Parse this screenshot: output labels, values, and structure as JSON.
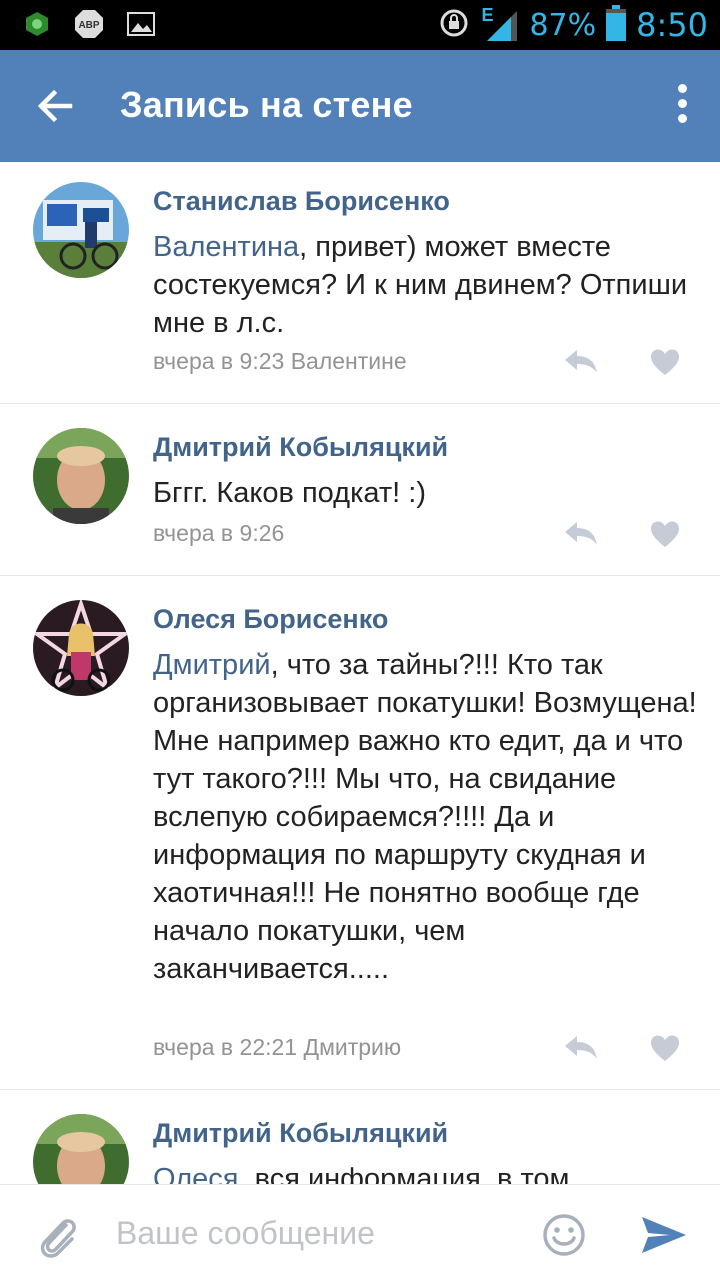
{
  "status_bar": {
    "icons": [
      "app-icon",
      "abp-icon",
      "image-icon"
    ],
    "abp_label": "ABP",
    "network": "E",
    "battery": "87%",
    "time": "8:50"
  },
  "toolbar": {
    "title": "Запись на стене",
    "back_icon": "arrow-left-icon",
    "menu_icon": "more-vert-icon"
  },
  "comments": [
    {
      "author": "Станислав Борисенко",
      "mention": "Валентина",
      "text": ", привет)  может вместе состекуемся?  И к ним двинем? Отпиши мне в л.с.",
      "meta": "вчера в 9:23 Валентине"
    },
    {
      "author": "Дмитрий Кобыляцкий",
      "mention": "",
      "text": "Бггг. Каков подкат! :)",
      "meta": "вчера в 9:26"
    },
    {
      "author": "Олеся Борисенко",
      "mention": "Дмитрий",
      "text": ", что за тайны?!!! Кто так организовывает покатушки! Возмущена! Мне например важно кто едит, да и что тут такого?!!! Мы что, на свидание вслепую собираемся?!!!! Да и информация по маршруту скудная и хаотичная!!! Не понятно  вообще где начало покатушки, чем заканчивается.....",
      "meta": "вчера в 22:21 Дмитрию"
    },
    {
      "author": "Дмитрий Кобыляцкий",
      "mention": "Олеся",
      "text": ", вся информация, в том",
      "meta": ""
    }
  ],
  "composer": {
    "placeholder": "Ваше сообщение",
    "value": ""
  },
  "colors": {
    "toolbar": "#5181b8",
    "link": "#42648b",
    "status_accent": "#33b5e5"
  }
}
